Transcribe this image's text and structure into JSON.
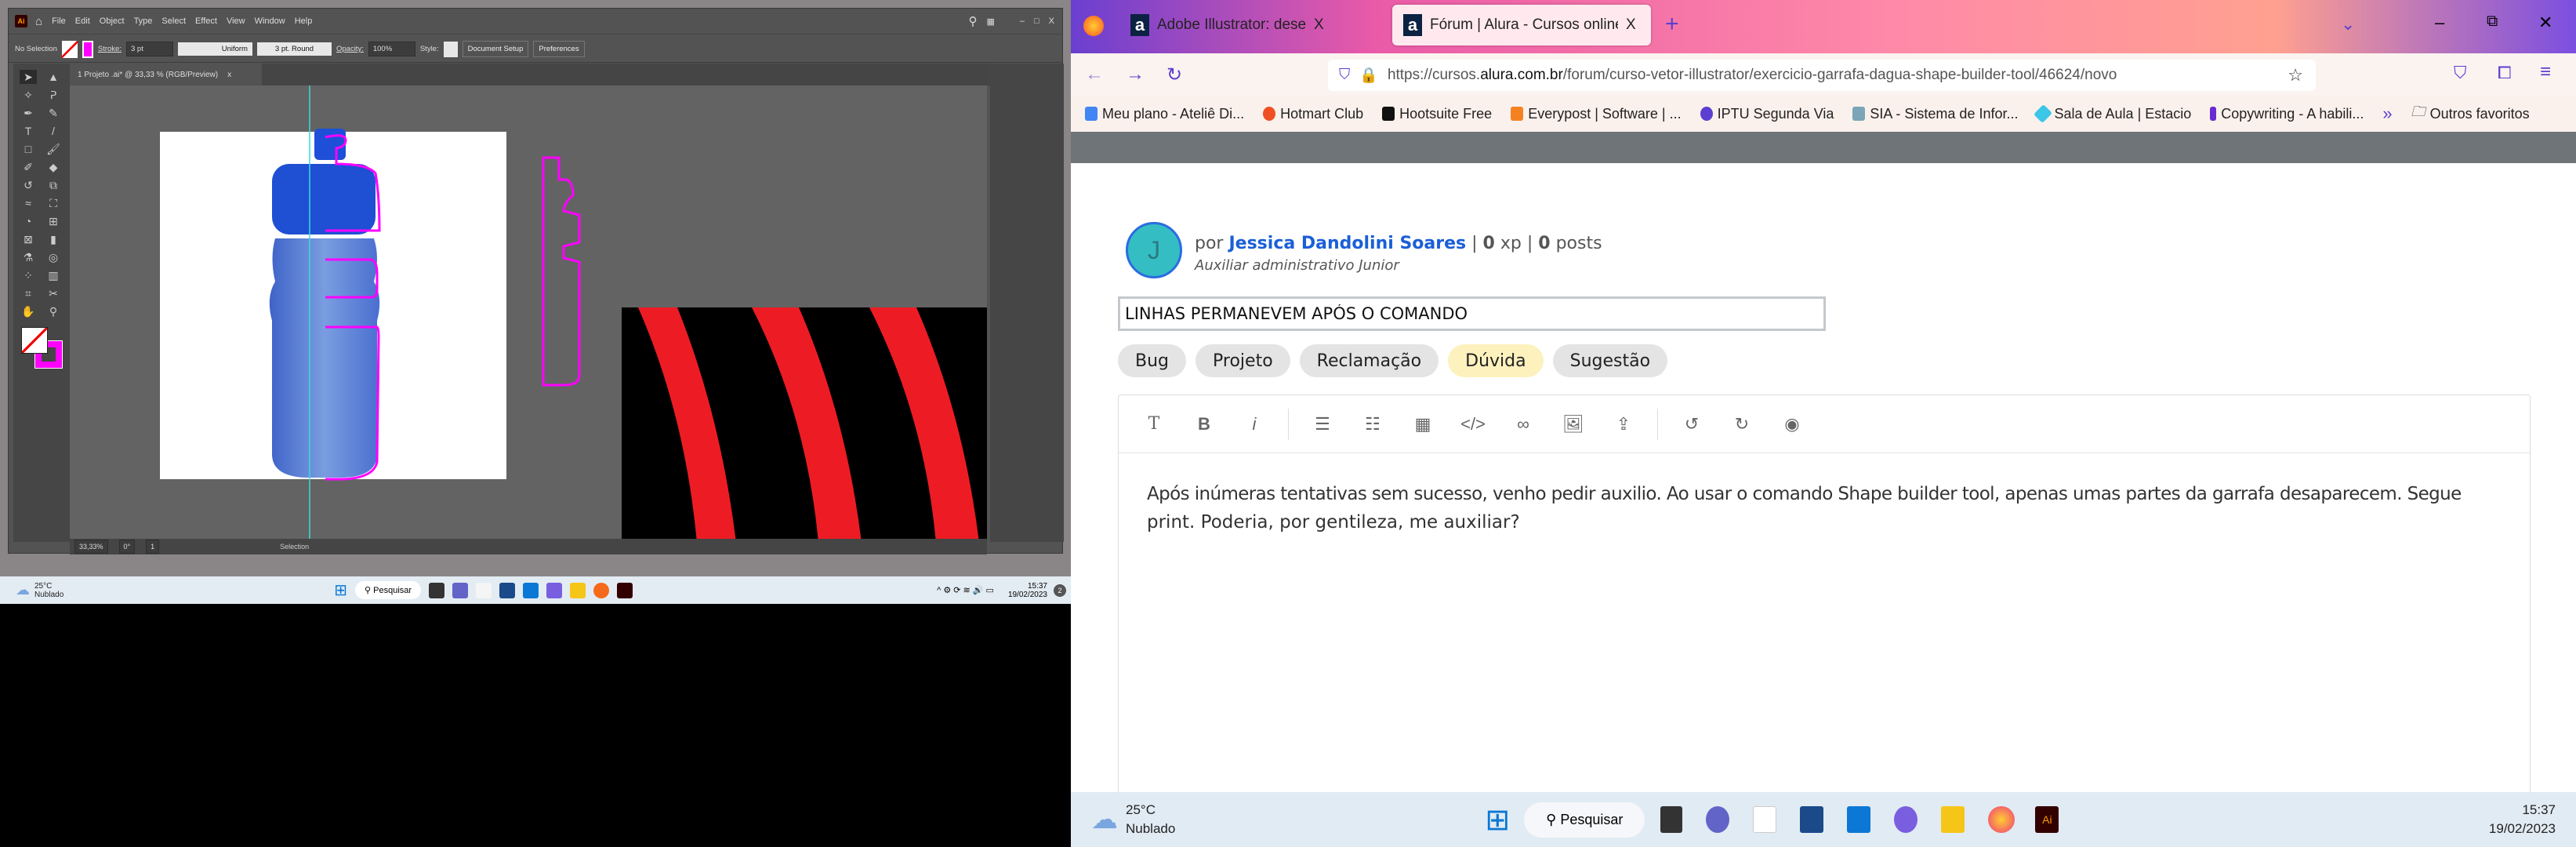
{
  "illustrator": {
    "menu": [
      "File",
      "Edit",
      "Object",
      "Type",
      "Select",
      "Effect",
      "View",
      "Window",
      "Help"
    ],
    "logo": "Ai",
    "control": {
      "selection": "No Selection",
      "stroke_label": "Stroke:",
      "stroke_value": "3 pt",
      "profile": "Uniform",
      "brush": "3 pt. Round",
      "opacity_label": "Opacity:",
      "opacity_value": "100%",
      "style_label": "Style:",
      "document_setup": "Document Setup",
      "preferences": "Preferences"
    },
    "doc_tab": "1 Projeto .ai* @ 33,33 % (RGB/Preview)",
    "doc_tab_close": "x",
    "status": {
      "zoom": "33,33%",
      "rotation": "0°",
      "artboard": "1",
      "tool": "Selection"
    },
    "colors": {
      "stroke": "#ff00ff",
      "fill": "none",
      "stripe_red": "#ed1c24",
      "stripe_black": "#000000"
    },
    "taskbar": {
      "temp": "25°C",
      "weather": "Nublado",
      "search": "Pesquisar",
      "time": "15:37",
      "date": "19/02/2023",
      "badge": "2"
    }
  },
  "firefox": {
    "tabs": [
      {
        "title": "Adobe Illustrator: desenho veto",
        "active": false
      },
      {
        "title": "Fórum | Alura - Cursos online de",
        "active": true
      }
    ],
    "tab_close": "X",
    "new_tab": "+",
    "url": {
      "prefix": "https://cursos.",
      "domain": "alura.com.br",
      "path": "/forum/curso-vetor-illustrator/exercicio-garrafa-dagua-shape-builder-tool/46624/novo"
    },
    "bookmarks": [
      {
        "label": "Meu plano - Ateliê Di...",
        "color": "#4285f4"
      },
      {
        "label": "Hotmart Club",
        "color": "#f04e23"
      },
      {
        "label": "Hootsuite Free",
        "color": "#111111"
      },
      {
        "label": "Everypost | Software | ...",
        "color": "#f58220"
      },
      {
        "label": "IPTU Segunda Via",
        "color": "#5b3fd0"
      },
      {
        "label": "SIA - Sistema de Infor...",
        "color": "#7aa6b8"
      },
      {
        "label": "Sala de Aula | Estacio",
        "color": "#3cc6e8"
      },
      {
        "label": "Copywriting - A habili...",
        "color": "#6a2bd0"
      }
    ],
    "bookmarks_more": "»",
    "other_bookmarks": "Outros favoritos"
  },
  "forum": {
    "avatar_letter": "J",
    "avatar_color": "#35bdc4",
    "by": "por",
    "author": "Jessica Dandolini Soares",
    "xp_value": "0",
    "xp_label": "xp",
    "posts_value": "0",
    "posts_label": "posts",
    "sep": "|",
    "role": "Auxiliar administrativo Junior",
    "title_value": "LINHAS PERMANEVEM APÓS O COMANDO",
    "tags": [
      {
        "label": "Bug",
        "selected": false
      },
      {
        "label": "Projeto",
        "selected": false
      },
      {
        "label": "Reclamação",
        "selected": false
      },
      {
        "label": "Dúvida",
        "selected": true
      },
      {
        "label": "Sugestão",
        "selected": false
      }
    ],
    "editor_tools": [
      "text",
      "bold",
      "italic",
      "ordered-list",
      "unordered-list",
      "table",
      "code",
      "link",
      "image",
      "image-upload",
      "undo",
      "redo",
      "preview"
    ],
    "body_line1": "Após inúmeras tentativas sem sucesso, venho pedir auxilio. Ao usar o comando Shape builder tool, apenas umas partes da garrafa desaparecem. Segue",
    "body_line2": "print. Poderia, por gentileza, me auxiliar?"
  },
  "taskbar": {
    "temp": "25°C",
    "weather": "Nublado",
    "search": "Pesquisar",
    "time": "15:37",
    "date": "19/02/2023"
  }
}
